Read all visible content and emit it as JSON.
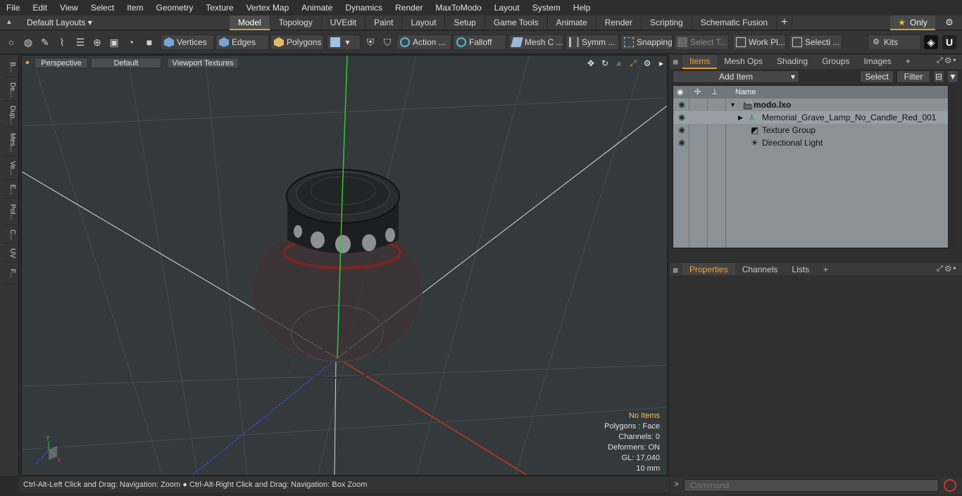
{
  "menu": [
    "File",
    "Edit",
    "View",
    "Select",
    "Item",
    "Geometry",
    "Texture",
    "Vertex Map",
    "Animate",
    "Dynamics",
    "Render",
    "MaxToModo",
    "Layout",
    "System",
    "Help"
  ],
  "layouts_label": "Default Layouts",
  "tabs": [
    "Model",
    "Topology",
    "UVEdit",
    "Paint",
    "Layout",
    "Setup",
    "Game Tools",
    "Animate",
    "Render",
    "Scripting",
    "Schematic Fusion"
  ],
  "active_tab": "Model",
  "only_label": "Only",
  "toolbar": {
    "vertices": "Vertices",
    "edges": "Edges",
    "polygons": "Polygons",
    "action": "Action",
    "falloff": "Falloff",
    "mesh_c": "Mesh C ...",
    "symm": "Symm ...",
    "snapping": "Snapping",
    "select_t": "Select T...",
    "work_pl": "Work Pl...",
    "selecti": "Selecti ...",
    "kits": "Kits"
  },
  "left_tabs": [
    "B...",
    "De...",
    "Dup...",
    "Mes...",
    "Ve...",
    "E...",
    "Pol...",
    "C...",
    "UV",
    "F..."
  ],
  "viewport": {
    "view_mode": "Perspective",
    "shading": "Default",
    "textures": "Viewport Textures",
    "stats": {
      "no_items": "No Items",
      "polygons": "Polygons : Face",
      "channels": "Channels: 0",
      "deformers": "Deformers: ON",
      "gl": "GL: 17,040",
      "scale": "10 mm"
    }
  },
  "status_text": "Ctrl-Alt-Left Click and Drag: Navigation: Zoom ● Ctrl-Alt-Right Click and Drag: Navigation: Box Zoom",
  "items_panel": {
    "tabs": [
      "Items",
      "Mesh Ops",
      "Shading",
      "Groups",
      "Images"
    ],
    "active": "Items",
    "add_item": "Add Item",
    "select": "Select",
    "filter": "Filter",
    "name_header": "Name",
    "rows": [
      {
        "label": "modo.lxo",
        "bold": true
      },
      {
        "label": "Memorial_Grave_Lamp_No_Candle_Red_001"
      },
      {
        "label": "Texture Group"
      },
      {
        "label": "Directional Light"
      }
    ]
  },
  "props_panel": {
    "tabs": [
      "Properties",
      "Channels",
      "Lists"
    ],
    "active": "Properties"
  },
  "command_placeholder": "Command",
  "colors": {
    "accent": "#e59c2c",
    "axis_x": "#d23a2a",
    "axis_y": "#35c43a",
    "axis_z": "#2d4fd6"
  }
}
